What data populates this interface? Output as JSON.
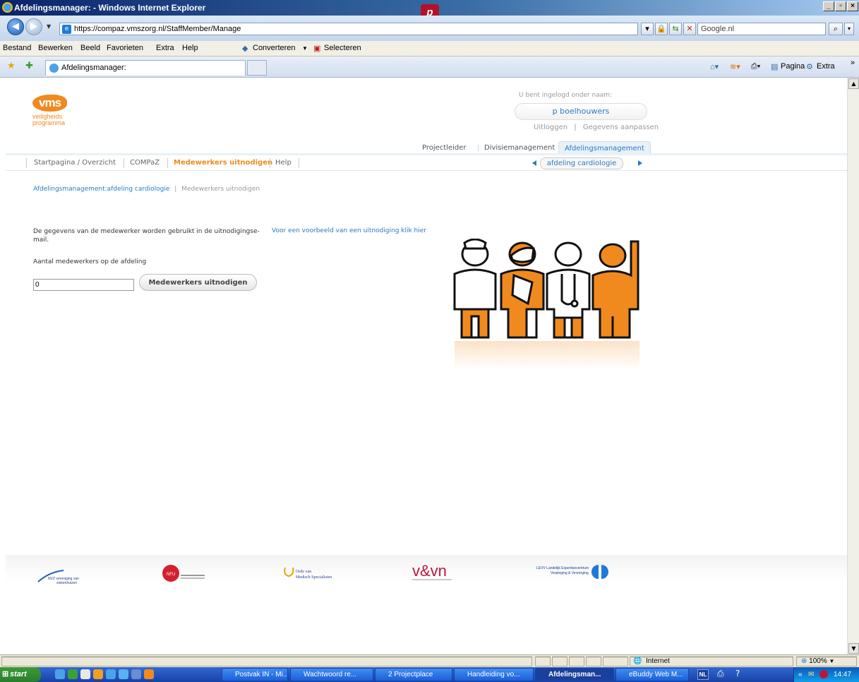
{
  "window": {
    "title": "Afdelingsmanager: - Windows Internet Explorer"
  },
  "browser": {
    "url": "https://compaz.vmszorg.nl/StaffMember/Manage",
    "search_placeholder": "Google.nl",
    "menu": [
      "Bestand",
      "Bewerken",
      "Beeld",
      "Favorieten",
      "Extra",
      "Help"
    ],
    "toolbar_convert": "Converteren",
    "toolbar_select": "Selecteren",
    "tab_title": "Afdelingsmanager:",
    "cmd_page": "Pagina",
    "cmd_extra": "Extra"
  },
  "site": {
    "logo_text": "vms",
    "logo_sub1": "veiligheids",
    "logo_sub2": "programma",
    "login_label": "U bent ingelogd onder naam:",
    "username": "p boelhouwers",
    "logout": "Uitloggen",
    "edit_profile": "Gegevens aanpassen",
    "top_tabs": [
      "Projectleider",
      "Divisiemanagement",
      "Afdelingsmanagement"
    ],
    "subnav": [
      "Startpagina / Overzicht",
      "COMPaZ",
      "Medewerkers uitnodigen",
      "Help"
    ],
    "department": "afdeling cardiologie",
    "breadcrumb_link": "Afdelingsmanagement:afdeling cardiologie",
    "breadcrumb_current": "Medewerkers uitnodigen",
    "description": "De gegevens van de medewerker worden gebruikt in de uitnodigingse-mail.",
    "example_link": "Voor een voorbeeld van een uitnodiging klik hier",
    "count_label": "Aantal medewerkers op de afdeling",
    "count_value": "0",
    "invite_button": "Medewerkers uitnodigen",
    "footer_logos": [
      "NVZ vereniging van ziekenhuizen",
      "NFU",
      "Orde van Medisch Specialisten",
      "v&vn",
      "LEVV Landelijk Expertisecentrum Verpleging & Verzorging"
    ],
    "accent_color": "#f08a1e",
    "link_color": "#2a7bc0"
  },
  "status": {
    "zone": "Internet",
    "zoom": "100%"
  },
  "taskbar": {
    "start": "start",
    "tasks": [
      "Postvak IN - Mi...",
      "Wachtwoord re...",
      "2 Projectplace",
      "Handleiding vo...",
      "Afdelingsman...",
      "eBuddy Web M..."
    ],
    "lang": "NL",
    "time": "14:47"
  }
}
